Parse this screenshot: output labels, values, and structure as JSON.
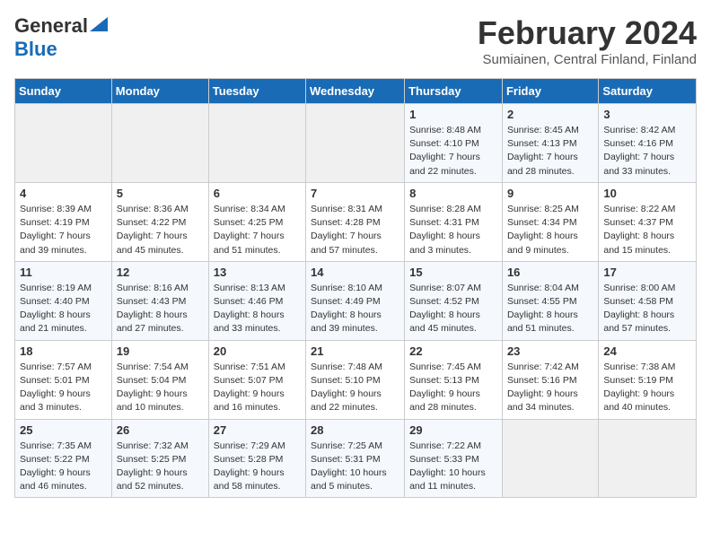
{
  "header": {
    "logo_general": "General",
    "logo_blue": "Blue",
    "month": "February 2024",
    "location": "Sumiainen, Central Finland, Finland"
  },
  "days_of_week": [
    "Sunday",
    "Monday",
    "Tuesday",
    "Wednesday",
    "Thursday",
    "Friday",
    "Saturday"
  ],
  "weeks": [
    [
      {
        "day": "",
        "info": ""
      },
      {
        "day": "",
        "info": ""
      },
      {
        "day": "",
        "info": ""
      },
      {
        "day": "",
        "info": ""
      },
      {
        "day": "1",
        "info": "Sunrise: 8:48 AM\nSunset: 4:10 PM\nDaylight: 7 hours\nand 22 minutes."
      },
      {
        "day": "2",
        "info": "Sunrise: 8:45 AM\nSunset: 4:13 PM\nDaylight: 7 hours\nand 28 minutes."
      },
      {
        "day": "3",
        "info": "Sunrise: 8:42 AM\nSunset: 4:16 PM\nDaylight: 7 hours\nand 33 minutes."
      }
    ],
    [
      {
        "day": "4",
        "info": "Sunrise: 8:39 AM\nSunset: 4:19 PM\nDaylight: 7 hours\nand 39 minutes."
      },
      {
        "day": "5",
        "info": "Sunrise: 8:36 AM\nSunset: 4:22 PM\nDaylight: 7 hours\nand 45 minutes."
      },
      {
        "day": "6",
        "info": "Sunrise: 8:34 AM\nSunset: 4:25 PM\nDaylight: 7 hours\nand 51 minutes."
      },
      {
        "day": "7",
        "info": "Sunrise: 8:31 AM\nSunset: 4:28 PM\nDaylight: 7 hours\nand 57 minutes."
      },
      {
        "day": "8",
        "info": "Sunrise: 8:28 AM\nSunset: 4:31 PM\nDaylight: 8 hours\nand 3 minutes."
      },
      {
        "day": "9",
        "info": "Sunrise: 8:25 AM\nSunset: 4:34 PM\nDaylight: 8 hours\nand 9 minutes."
      },
      {
        "day": "10",
        "info": "Sunrise: 8:22 AM\nSunset: 4:37 PM\nDaylight: 8 hours\nand 15 minutes."
      }
    ],
    [
      {
        "day": "11",
        "info": "Sunrise: 8:19 AM\nSunset: 4:40 PM\nDaylight: 8 hours\nand 21 minutes."
      },
      {
        "day": "12",
        "info": "Sunrise: 8:16 AM\nSunset: 4:43 PM\nDaylight: 8 hours\nand 27 minutes."
      },
      {
        "day": "13",
        "info": "Sunrise: 8:13 AM\nSunset: 4:46 PM\nDaylight: 8 hours\nand 33 minutes."
      },
      {
        "day": "14",
        "info": "Sunrise: 8:10 AM\nSunset: 4:49 PM\nDaylight: 8 hours\nand 39 minutes."
      },
      {
        "day": "15",
        "info": "Sunrise: 8:07 AM\nSunset: 4:52 PM\nDaylight: 8 hours\nand 45 minutes."
      },
      {
        "day": "16",
        "info": "Sunrise: 8:04 AM\nSunset: 4:55 PM\nDaylight: 8 hours\nand 51 minutes."
      },
      {
        "day": "17",
        "info": "Sunrise: 8:00 AM\nSunset: 4:58 PM\nDaylight: 8 hours\nand 57 minutes."
      }
    ],
    [
      {
        "day": "18",
        "info": "Sunrise: 7:57 AM\nSunset: 5:01 PM\nDaylight: 9 hours\nand 3 minutes."
      },
      {
        "day": "19",
        "info": "Sunrise: 7:54 AM\nSunset: 5:04 PM\nDaylight: 9 hours\nand 10 minutes."
      },
      {
        "day": "20",
        "info": "Sunrise: 7:51 AM\nSunset: 5:07 PM\nDaylight: 9 hours\nand 16 minutes."
      },
      {
        "day": "21",
        "info": "Sunrise: 7:48 AM\nSunset: 5:10 PM\nDaylight: 9 hours\nand 22 minutes."
      },
      {
        "day": "22",
        "info": "Sunrise: 7:45 AM\nSunset: 5:13 PM\nDaylight: 9 hours\nand 28 minutes."
      },
      {
        "day": "23",
        "info": "Sunrise: 7:42 AM\nSunset: 5:16 PM\nDaylight: 9 hours\nand 34 minutes."
      },
      {
        "day": "24",
        "info": "Sunrise: 7:38 AM\nSunset: 5:19 PM\nDaylight: 9 hours\nand 40 minutes."
      }
    ],
    [
      {
        "day": "25",
        "info": "Sunrise: 7:35 AM\nSunset: 5:22 PM\nDaylight: 9 hours\nand 46 minutes."
      },
      {
        "day": "26",
        "info": "Sunrise: 7:32 AM\nSunset: 5:25 PM\nDaylight: 9 hours\nand 52 minutes."
      },
      {
        "day": "27",
        "info": "Sunrise: 7:29 AM\nSunset: 5:28 PM\nDaylight: 9 hours\nand 58 minutes."
      },
      {
        "day": "28",
        "info": "Sunrise: 7:25 AM\nSunset: 5:31 PM\nDaylight: 10 hours\nand 5 minutes."
      },
      {
        "day": "29",
        "info": "Sunrise: 7:22 AM\nSunset: 5:33 PM\nDaylight: 10 hours\nand 11 minutes."
      },
      {
        "day": "",
        "info": ""
      },
      {
        "day": "",
        "info": ""
      }
    ]
  ]
}
